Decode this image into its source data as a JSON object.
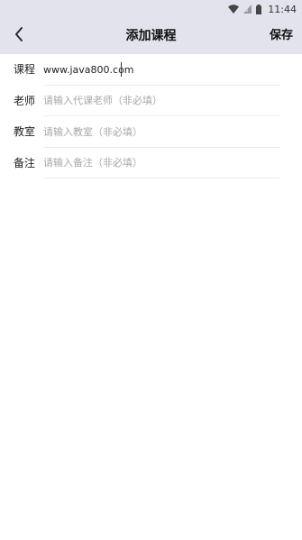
{
  "status_bar": {
    "time": "11:44",
    "icons": [
      "wifi-icon",
      "signal-icon",
      "battery-icon"
    ]
  },
  "nav": {
    "back_icon": "chevron-left-icon",
    "title": "添加课程",
    "save_label": "保存"
  },
  "form": {
    "rows": [
      {
        "label": "课程",
        "value": "www.java800.com",
        "placeholder": ""
      },
      {
        "label": "老师",
        "value": "",
        "placeholder": "请输入代课老师（非必填）"
      },
      {
        "label": "教室",
        "value": "",
        "placeholder": "请输入教室（非必填）"
      },
      {
        "label": "备注",
        "value": "",
        "placeholder": "请输入备注（非必填）"
      }
    ]
  },
  "colors": {
    "bar_background": "#e2e3ec",
    "placeholder": "#a8a8a8",
    "divider": "#ececec"
  }
}
